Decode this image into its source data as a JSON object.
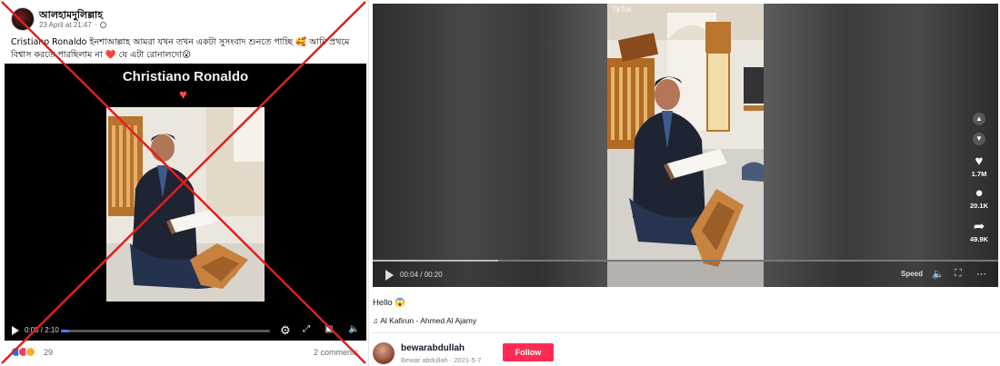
{
  "facebook": {
    "page_name": "আলহামদুলিল্লাহ",
    "post_date": "23 April at 21:47",
    "post_text": "Cristiano Ronaldo ইনশাআল্লাহ আমরা যখন তখন একটা সুসংবাদ শুনতে পাচ্ছি 🥰 আমি প্রথমে বিশ্বাস করতে পারছিলাম না ❤️ যে এটা রোনালদো😮",
    "video_title": "Christiano Ronaldo",
    "video_heart": "♥",
    "time": "0:05 / 2:10",
    "progress": 0.04,
    "reaction_count": "29",
    "comments": "2 comments",
    "icons": [
      "play-icon",
      "settings-gear-icon",
      "expand-icon",
      "picture-in-picture-icon",
      "volume-icon",
      "globe-icon"
    ]
  },
  "tiktok": {
    "watermark": "TikTok",
    "time": "00:04 / 00:20",
    "progress": 0.2,
    "speed_label": "Speed",
    "likes": "1.7M",
    "comments": "20.1K",
    "shares": "49.9K",
    "caption": "Hello 😱",
    "music": "♫ Al Kafirun - Ahmed Al Ajamy",
    "username": "bewarabdullah",
    "user_subline": "Bewar abdullah · 2021-5-7",
    "follow_label": "Follow",
    "colors": {
      "follow": "#fe2c55",
      "overlay_x": "#e02020"
    }
  }
}
